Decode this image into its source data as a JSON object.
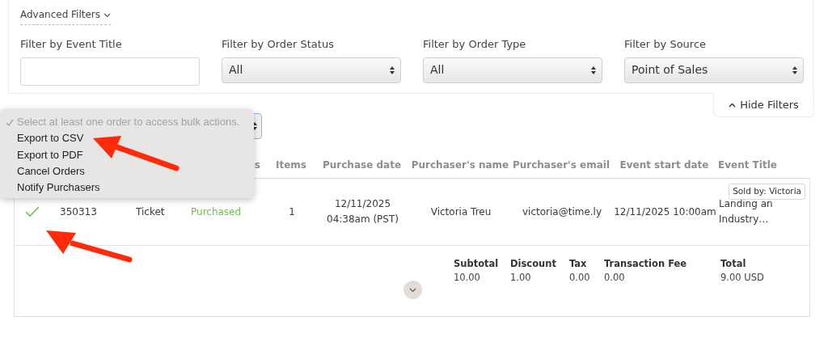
{
  "advanced_filters": {
    "label": "Advanced Filters",
    "expanded": true
  },
  "filters": [
    {
      "label": "Filter by Event Title",
      "kind": "text"
    },
    {
      "label": "Filter by Order Status",
      "kind": "select",
      "value": "All"
    },
    {
      "label": "Filter by Order Type",
      "kind": "select",
      "value": "All"
    },
    {
      "label": "Filter by Source",
      "kind": "select",
      "value": "Point of Sales"
    }
  ],
  "hide_filters": {
    "label": "Hide Filters"
  },
  "bulk_menu": {
    "items": [
      {
        "label": "Select at least one order to access bulk actions.",
        "checked": true,
        "disabled": true
      },
      {
        "label": "Export to CSV",
        "checked": false,
        "disabled": false
      },
      {
        "label": "Export to PDF",
        "checked": false,
        "disabled": false
      },
      {
        "label": "Cancel Orders",
        "checked": false,
        "disabled": false
      },
      {
        "label": "Notify Purchasers",
        "checked": false,
        "disabled": false
      }
    ]
  },
  "table": {
    "columns": [
      "s",
      "Items",
      "Purchase date",
      "Purchaser's name",
      "Purchaser's email",
      "Event start date",
      "Event Title"
    ],
    "rows": [
      {
        "checked": true,
        "id": "350313",
        "type": "Ticket",
        "status": "Purchased",
        "items": "1",
        "purchase_date": "12/11/2025 04:38am (PST)",
        "name": "Victoria Treu",
        "email": "victoria@time.ly",
        "start_date": "12/11/2025 10:00am",
        "event_title": "Landing an Industry…",
        "badge": "Sold by: Victoria",
        "expanded": false,
        "summary": [
          {
            "label": "Subtotal",
            "value": "10.00"
          },
          {
            "label": "Discount",
            "value": "1.00"
          },
          {
            "label": "Tax",
            "value": "0.00"
          },
          {
            "label": "Transaction Fee",
            "value": "0.00"
          },
          {
            "label": "Total",
            "value": "9.00 USD"
          }
        ]
      }
    ]
  }
}
